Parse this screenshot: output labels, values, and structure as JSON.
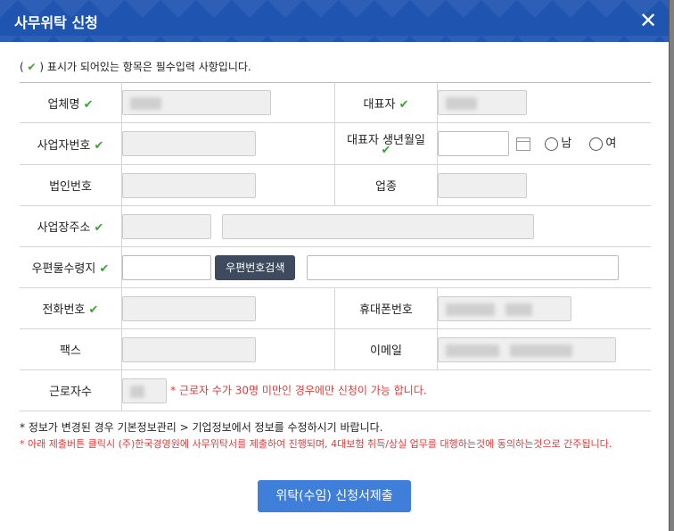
{
  "dialog": {
    "title": "사무위탁 신청",
    "close_label": "✕"
  },
  "notice": {
    "open_paren": "(",
    "check": "✔",
    "text": ") 표시가 되어있는 항목은 필수입력 사항입니다."
  },
  "form": {
    "company_name_label": "업체명",
    "ceo_label": "대표자",
    "business_number_label": "사업자번호",
    "ceo_birth_label": "대표자 생년월일",
    "gender_male": "남",
    "gender_female": "여",
    "corp_number_label": "법인번호",
    "industry_label": "업종",
    "address_label": "사업장주소",
    "mail_label": "우편물수령지",
    "postcode_search_button": "우편번호검색",
    "phone_label": "전화번호",
    "mobile_label": "휴대폰번호",
    "fax_label": "팩스",
    "email_label": "이메일",
    "workers_label": "근로자수",
    "workers_warning": "* 근로자 수가 30명 미만인 경우에만 신청이 가능 합니다.",
    "check": "✔"
  },
  "footer": {
    "info_notice": "* 정보가 변경된 경우 기본정보관리 > 기업정보에서 정보를 수정하시기 바랍니다.",
    "consent_notice": "* 아래 제출버튼 클릭시 (주)한국경영원에 사무위탁서를 제출하여 진행되며, 4대보험 취득/상실 업무를 대행하는것에 동의하는것으로 간주됩니다.",
    "submit_button": "위탁(수임) 신청서제출"
  },
  "colors": {
    "header": "#1f55b0",
    "check": "#3aa535",
    "warning": "#e03a3a",
    "submit": "#3f7ed9"
  }
}
